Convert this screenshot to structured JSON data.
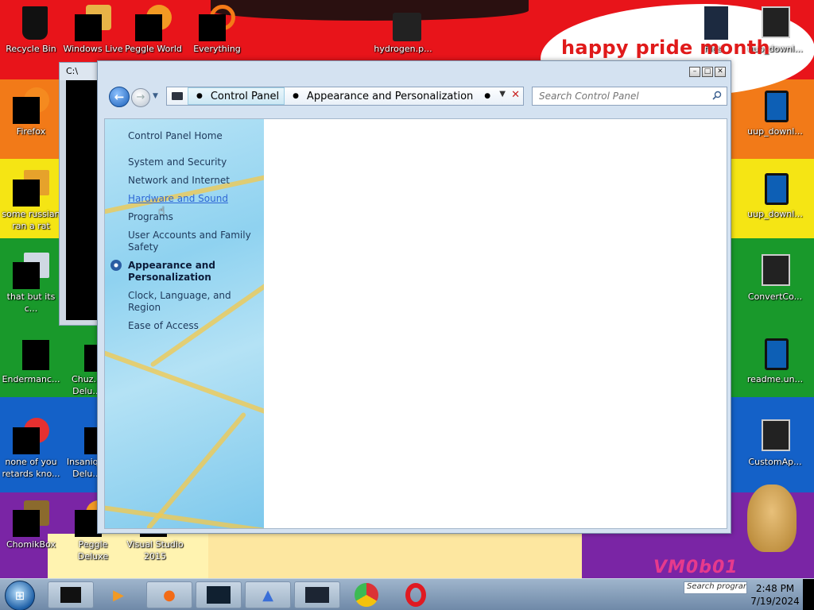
{
  "desktop": {
    "banner_text": "happy pride month",
    "watermark": "VM0b01",
    "icons": [
      {
        "label": "Recycle Bin"
      },
      {
        "label": "Windows Live"
      },
      {
        "label": "Peggle World"
      },
      {
        "label": "Everything"
      },
      {
        "label": "hydrogen.p..."
      },
      {
        "label": "files"
      },
      {
        "label": "uup_downl..."
      },
      {
        "label": "Firefox"
      },
      {
        "label": "uup_downl..."
      },
      {
        "label": "some russian ran a rat"
      },
      {
        "label": "uup_downl..."
      },
      {
        "label": "that but its c..."
      },
      {
        "label": "ConvertCo..."
      },
      {
        "label": "Endermanc..."
      },
      {
        "label": "Chuz... Delu..."
      },
      {
        "label": "readme.un..."
      },
      {
        "label": "none of you retards kno..."
      },
      {
        "label": "Insaniq... Delu..."
      },
      {
        "label": "CustomAp..."
      },
      {
        "label": "ChomikBox"
      },
      {
        "label": "Peggle Deluxe"
      },
      {
        "label": "Visual Studio 2015"
      }
    ]
  },
  "console_window": {
    "title": "C:\\"
  },
  "control_panel": {
    "address": {
      "crumbs": [
        "Control Panel",
        "Appearance and Personalization"
      ],
      "search_placeholder": "Search Control Panel"
    },
    "nav": {
      "home": "Control Panel Home",
      "items": [
        "System and Security",
        "Network and Internet",
        "Hardware and Sound",
        "Programs",
        "User Accounts and Family Safety",
        "Appearance and Personalization",
        "Clock, Language, and Region",
        "Ease of Access"
      ],
      "hovered_index": 2,
      "current_index": 5
    }
  },
  "taskbar": {
    "search_placeholder": "Search programs",
    "time": "2:48 PM",
    "date": "7/19/2024"
  }
}
